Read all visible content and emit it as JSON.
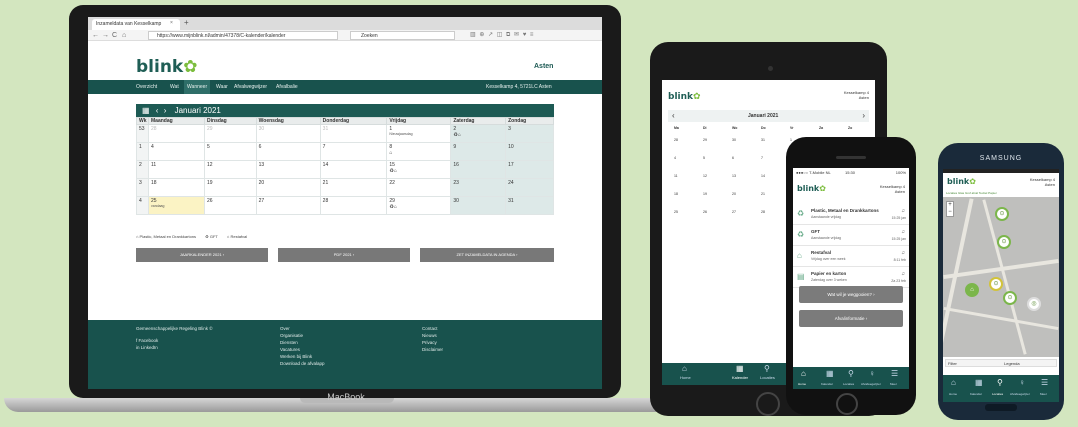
{
  "laptop": {
    "brand": "MacBook",
    "tab_title": "Inzameldata van Kesselkamp",
    "tab_close": "×",
    "tab_new": "+",
    "url": "https://www.mijnblink.nl/admin/47378/C-kalender/kalender",
    "search_placeholder": "Zoeken",
    "nav_back": "←",
    "nav_forward": "→",
    "nav_reload": "C",
    "nav_home": "⌂",
    "toolbar_icons": "▥ ⊕ ↗ ◫ ⧉ ✉ ♥ ≡",
    "site": {
      "logo": "blink",
      "city_logo": "Asten",
      "nav": [
        "Overzicht",
        "Wat",
        "Wanneer",
        "Waar",
        "Afvalwegwijzer",
        "Afvalbalie"
      ],
      "nav_active": 2,
      "address": "Kesselkamp 4, 5721LC Asten",
      "calendar": {
        "title": "Januari 2021",
        "nav_prev": "‹",
        "nav_next": "›",
        "cal_icon": "▦",
        "headers": [
          "Wk",
          "Maandag",
          "Dinsdag",
          "Woensdag",
          "Donderdag",
          "Vrijdag",
          "Zaterdag",
          "Zondag"
        ],
        "weeks": [
          {
            "wk": "53",
            "days": [
              "28",
              "29",
              "30",
              "31",
              "1",
              "2",
              "3"
            ],
            "subs": [
              "",
              "",
              "",
              "",
              "Nieuwjaarsdag",
              "",
              ""
            ],
            "events": [
              "",
              "",
              "",
              "",
              "",
              "♻⌂",
              ""
            ]
          },
          {
            "wk": "1",
            "days": [
              "4",
              "5",
              "6",
              "7",
              "8",
              "9",
              "10"
            ],
            "subs": [
              "",
              "",
              "",
              "",
              "",
              "",
              ""
            ],
            "events": [
              "",
              "",
              "",
              "",
              "⌂",
              "",
              ""
            ]
          },
          {
            "wk": "2",
            "days": [
              "11",
              "12",
              "13",
              "14",
              "15",
              "16",
              "17"
            ],
            "subs": [
              "",
              "",
              "",
              "",
              "",
              "",
              ""
            ],
            "events": [
              "",
              "",
              "",
              "",
              "♻⌂",
              "",
              ""
            ]
          },
          {
            "wk": "3",
            "days": [
              "18",
              "19",
              "20",
              "21",
              "22",
              "23",
              "24"
            ],
            "subs": [
              "",
              "",
              "",
              "",
              "",
              "",
              ""
            ],
            "events": [
              "",
              "",
              "",
              "",
              "",
              "",
              ""
            ]
          },
          {
            "wk": "4",
            "days": [
              "25",
              "26",
              "27",
              "28",
              "29",
              "30",
              "31"
            ],
            "subs": [
              "vandaag",
              "",
              "",
              "",
              "",
              "",
              ""
            ],
            "events": [
              "",
              "",
              "",
              "",
              "♻⌂",
              "",
              ""
            ]
          }
        ]
      },
      "legend": [
        "Plastic, Metaal en Drankkartons",
        "GFT",
        "Restafval"
      ],
      "buttons": [
        "JAARKALENDER 2021 ›",
        "PDF 2021 ›",
        "ZET INZAMELDATA IN AGENDA ›"
      ],
      "footer": {
        "col1_title": "Gemeenschappelijke Regeling Blink ©",
        "col1_links": [
          "f  Facebook",
          "in  LinkedIn"
        ],
        "col2_links": [
          "Over",
          "Organisatie",
          "Diensten",
          "Vacatures",
          "Werken bij Blink",
          "Download de afvalapp"
        ],
        "col3_links": [
          "Contact",
          "Nieuws",
          "Privacy",
          "Disclaimer"
        ]
      }
    }
  },
  "tablet": {
    "logo": "blink",
    "address": "Kesselkamp 4\nAsten",
    "month": "Januari 2021",
    "prev": "‹",
    "next": "›",
    "weekdays": [
      "Ma",
      "Di",
      "Wo",
      "Do",
      "Vr",
      "Za",
      "Zo"
    ],
    "rows": [
      [
        "28",
        "29",
        "30",
        "31",
        "1",
        "2",
        "3"
      ],
      [
        "4",
        "5",
        "6",
        "7",
        "8",
        "9",
        "10"
      ],
      [
        "11",
        "12",
        "13",
        "14",
        "15",
        "16",
        "17"
      ],
      [
        "18",
        "19",
        "20",
        "21",
        "22",
        "23",
        "24"
      ],
      [
        "25",
        "26",
        "27",
        "28",
        "29",
        "30",
        "31"
      ]
    ],
    "tabs": [
      "Home",
      "Kalender",
      "Locaties"
    ]
  },
  "iphone": {
    "carrier": "●●●○○ T-Mobile NL",
    "time": "15:30",
    "battery": "100%",
    "logo": "blink",
    "address": "Kesselkamp 4\nAsten",
    "items": [
      {
        "title": "Plastic, Metaal en Drankkartons",
        "sub": "Aanstaande vrijdag",
        "right": "15:25 jan"
      },
      {
        "title": "GFT",
        "sub": "Aanstaande vrijdag",
        "right": "15:25 jan"
      },
      {
        "title": "Restafval",
        "sub": "Vrijdag over een week",
        "right": "8:11 feb"
      },
      {
        "title": "Papier en karton",
        "sub": "Zaterdag over 3 weken",
        "right": "Za 23 feb"
      }
    ],
    "buttons": [
      "Wat wil je weggooien?  ›",
      "Afvalinformatie  ›"
    ],
    "tabs": [
      "Home",
      "Kalender",
      "Locaties",
      "Afvalwegwijzer",
      "Meer"
    ]
  },
  "samsung": {
    "brand": "SAMSUNG",
    "logo": "blink",
    "address": "Kesselkamp 4\nAsten",
    "crumbs": "Locaties Glas Grof afval Textiel Papier",
    "filter": "Filter",
    "legend": "Legenda",
    "tabs": [
      "Home",
      "Kalender",
      "Locaties",
      "Afvalwegwijzer",
      "Meer"
    ]
  }
}
